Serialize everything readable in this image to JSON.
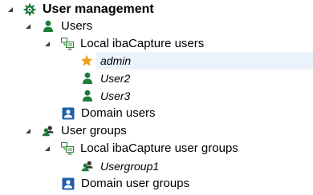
{
  "tree": {
    "root": {
      "label": "User management",
      "icon": "gear-icon",
      "expanded": true
    },
    "users": {
      "label": "Users",
      "icon": "user-icon",
      "expanded": true
    },
    "local_users": {
      "label": "Local ibaCapture users",
      "icon": "network-computer-icon",
      "expanded": true
    },
    "user_admin": {
      "label": "admin",
      "icon": "star-icon",
      "selected": true
    },
    "user_2": {
      "label": "User2",
      "icon": "user-icon"
    },
    "user_3": {
      "label": "User3",
      "icon": "user-icon"
    },
    "domain_users": {
      "label": "Domain users",
      "icon": "domain-user-icon"
    },
    "user_groups": {
      "label": "User groups",
      "icon": "user-group-icon",
      "expanded": true
    },
    "local_groups": {
      "label": "Local ibaCapture user groups",
      "icon": "network-computer-icon",
      "expanded": true
    },
    "group_1": {
      "label": "Usergroup1",
      "icon": "user-group-icon"
    },
    "domain_groups": {
      "label": "Domain user groups",
      "icon": "domain-user-icon"
    }
  },
  "colors": {
    "user_green": "#1e7b3a",
    "group_dark": "#2b3a33",
    "star_orange": "#f0a020",
    "domain_blue": "#1f5fa8",
    "selection": "#eaf3fb"
  }
}
